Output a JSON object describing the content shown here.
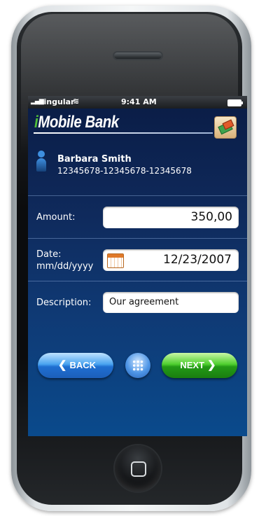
{
  "status_bar": {
    "signal": "▂▄▆",
    "carrier": "cingular",
    "wifi": "≋",
    "time": "9:41 AM"
  },
  "app": {
    "logo_i": "i",
    "logo_rest": "Mobile Bank"
  },
  "user": {
    "name": "Barbara Smith",
    "account": "12345678-12345678-12345678"
  },
  "form": {
    "amount": {
      "label": "Amount:",
      "value": "350,00"
    },
    "date": {
      "label_line1": "Date:",
      "label_line2": "mm/dd/yyyy",
      "value": "12/23/2007"
    },
    "description": {
      "label": "Description:",
      "value": "Our agreement"
    }
  },
  "buttons": {
    "back_arrow": "❮",
    "back": "BACK",
    "next": "NEXT",
    "next_arrow": "❯"
  },
  "colors": {
    "accent_green": "#4fbf3a",
    "back_blue": "#1f6fd1",
    "next_green": "#239a16"
  }
}
